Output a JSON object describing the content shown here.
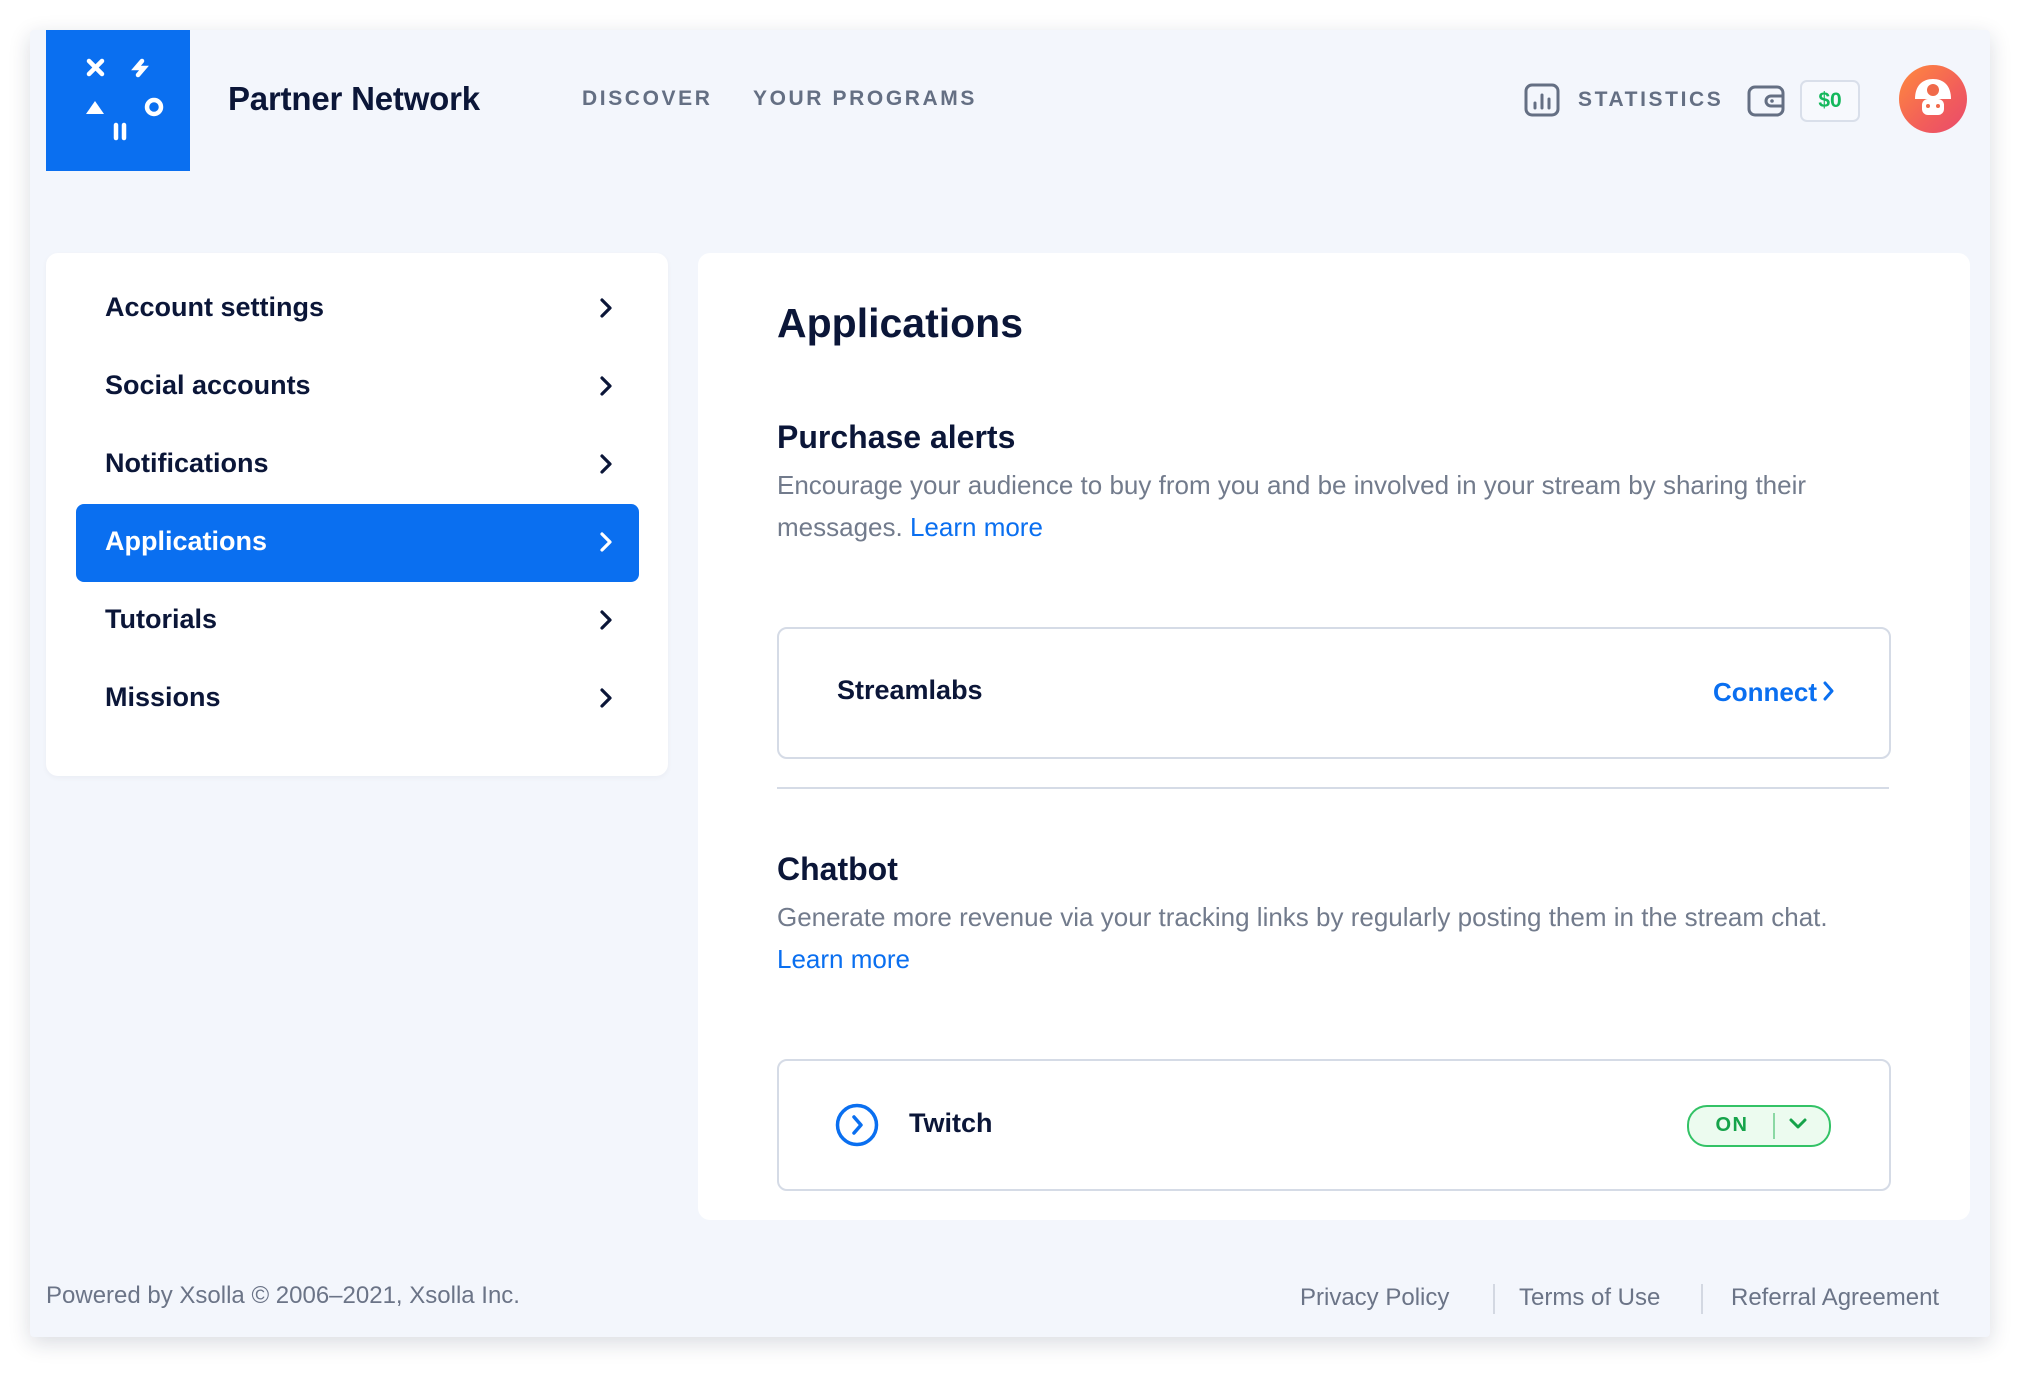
{
  "header": {
    "brand": "Partner Network",
    "nav": [
      "DISCOVER",
      "YOUR PROGRAMS"
    ],
    "statistics_label": "STATISTICS",
    "balance": "$0"
  },
  "sidebar": {
    "items": [
      {
        "label": "Account settings",
        "active": false
      },
      {
        "label": "Social accounts",
        "active": false
      },
      {
        "label": "Notifications",
        "active": false
      },
      {
        "label": "Applications",
        "active": true
      },
      {
        "label": "Tutorials",
        "active": false
      },
      {
        "label": "Missions",
        "active": false
      }
    ]
  },
  "main": {
    "title": "Applications",
    "purchase_alerts": {
      "title": "Purchase alerts",
      "description": "Encourage your audience to buy from you and be involved in your stream by sharing their messages.",
      "learn_more": "Learn more",
      "app_name": "Streamlabs",
      "connect_label": "Connect"
    },
    "chatbot": {
      "title": "Chatbot",
      "description": "Generate more revenue via your tracking links by regularly posting them in the stream chat.",
      "learn_more": "Learn more",
      "app_name": "Twitch",
      "toggle_label": "ON"
    }
  },
  "footer": {
    "copyright": "Powered by Xsolla © 2006–2021, Xsolla Inc.",
    "links": [
      "Privacy Policy",
      "Terms of Use",
      "Referral Agreement"
    ]
  },
  "colors": {
    "accent": "#0a6ff0",
    "page_bg": "#f3f6fc",
    "success": "#16a34a",
    "balance": "#14b85c"
  },
  "icons": {
    "logo": "xsolla-logo-icon",
    "statistics": "bar-chart-icon",
    "wallet": "wallet-icon",
    "avatar": "mushroom-avatar-icon",
    "chevron": "chevron-right-icon",
    "expand": "circle-chevron-right-icon",
    "toggle_dropdown": "chevron-down-icon"
  }
}
